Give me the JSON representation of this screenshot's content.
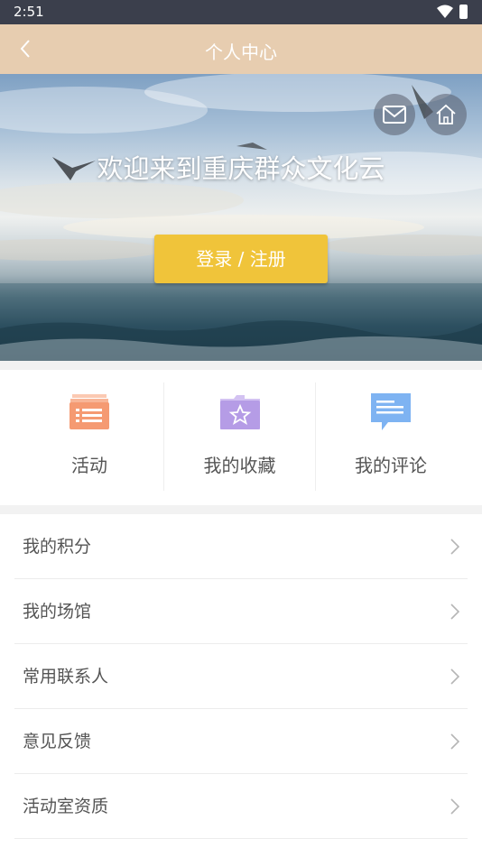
{
  "status_bar": {
    "time": "2:51"
  },
  "header": {
    "title": "个人中心"
  },
  "hero": {
    "welcome": "欢迎来到重庆群众文化云",
    "login_button": "登录 / 注册"
  },
  "quick_actions": [
    {
      "label": "活动",
      "icon": "activity-list-icon",
      "color": "#f59a72"
    },
    {
      "label": "我的收藏",
      "icon": "favorites-folder-icon",
      "color": "#b59ce6"
    },
    {
      "label": "我的评论",
      "icon": "comment-bubble-icon",
      "color": "#7eb3f2"
    }
  ],
  "menu": [
    {
      "label": "我的积分"
    },
    {
      "label": "我的场馆"
    },
    {
      "label": "常用联系人"
    },
    {
      "label": "意见反馈"
    },
    {
      "label": "活动室资质"
    }
  ],
  "colors": {
    "header_bg": "#e7cdb0",
    "status_bg": "#3b3f4c",
    "login_button": "#f0c43a"
  }
}
